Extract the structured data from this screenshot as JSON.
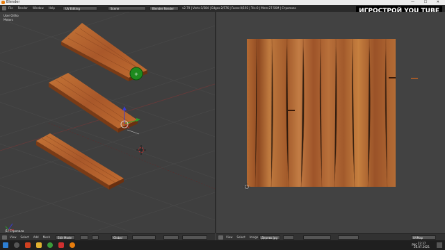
{
  "window": {
    "title": "Blender",
    "controls": "— ☐ ✕"
  },
  "info_bar": {
    "menu": [
      "File",
      "Render",
      "Window",
      "Help"
    ],
    "layout_select": "UV Editing",
    "scene_select": "Scene",
    "engine_select": "Blender Render",
    "stats": "v2.79 | Verts:1/384 | Edges:2/576 | Faces:0/192 | Tris:0 | Mem:27.56M | Стропила"
  },
  "watermark": "ИГРОСТРОЙ YOU TUBE",
  "viewport_3d": {
    "view_label": "User Ortho",
    "unit_label": "Meters",
    "object_label": "(1) Стропила",
    "header_menu": [
      "View",
      "Select",
      "Add",
      "Mesh"
    ],
    "mode": "Edit Mode",
    "pivot": "Global"
  },
  "uv_editor": {
    "header_menu": [
      "View",
      "Select",
      "Image",
      "UVs"
    ],
    "image_name": "Дерево.jpg",
    "uv_map": "UVMap"
  },
  "taskbar": {
    "language": "РУС",
    "time": "22:37",
    "date": "26.07.2021"
  },
  "colors": {
    "wood_top": "#b5652e",
    "wood_side": "#7a3b16",
    "texture_base": "#b06a35",
    "gizmo_green": "#1e8a1e"
  }
}
